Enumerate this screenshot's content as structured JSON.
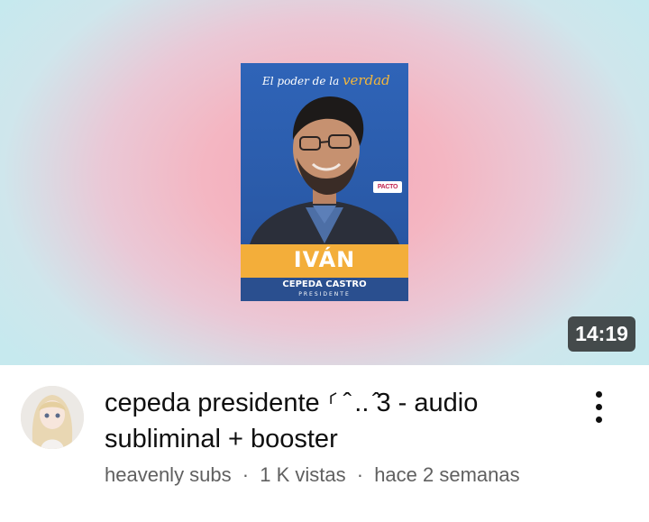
{
  "thumbnail": {
    "poster_slogan_prefix": "El poder de la",
    "poster_slogan_accent": "verdad",
    "poster_name": "IVÁN",
    "poster_surname": "CEPEDA CASTRO",
    "poster_role": "PRESIDENTE",
    "duration": "14:19"
  },
  "video": {
    "title": "cepeda presidente ⸂ ̂ .. ̂3 - audio subliminal + booster",
    "channel": "heavenly subs",
    "views": "1 K vistas",
    "age": "hace 2 semanas",
    "separator": "·"
  },
  "icons": {
    "menu": "more-vert-icon",
    "avatar": "channel-avatar"
  },
  "colors": {
    "poster_blue": "#2f64b8",
    "poster_gold": "#f3ae3a",
    "meta_gray": "#606060"
  }
}
